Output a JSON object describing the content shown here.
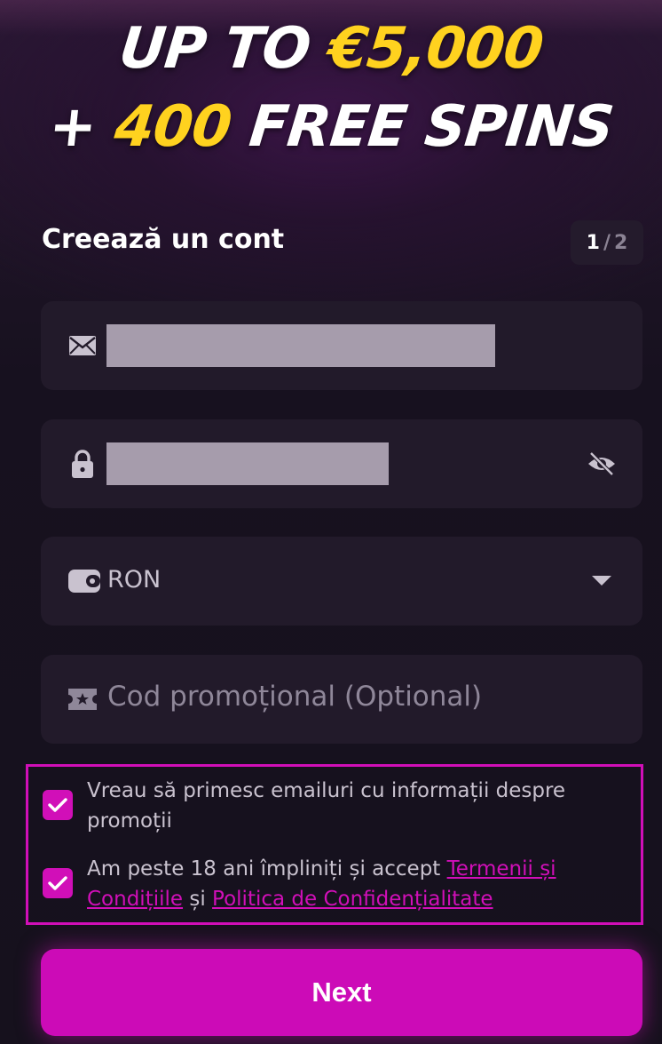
{
  "promo": {
    "line1_white": "UP TO ",
    "line1_yellow": "€5,000",
    "line2_white_pre": "+ ",
    "line2_yellow": "400",
    "line2_white_post": " FREE SPINS"
  },
  "form": {
    "title": "Creează un cont",
    "step_current": "1",
    "step_separator": "/",
    "step_total": "2"
  },
  "fields": {
    "currency_value": "RON",
    "promo_placeholder": "Cod promoțional (Optional)"
  },
  "consent": {
    "emails_label": "Vreau să primesc emailuri cu informații despre promoții",
    "age_prefix": "Am peste 18 ani împliniți și accept ",
    "terms_link": "Termenii și Condițiile",
    "and_word": " și ",
    "privacy_link": "Politica de Confidențialitate"
  },
  "button": {
    "next_label": "Next"
  },
  "colors": {
    "accent": "#cc0bb7",
    "promo_yellow": "#ffd21f",
    "field_bg": "#221a2a"
  }
}
